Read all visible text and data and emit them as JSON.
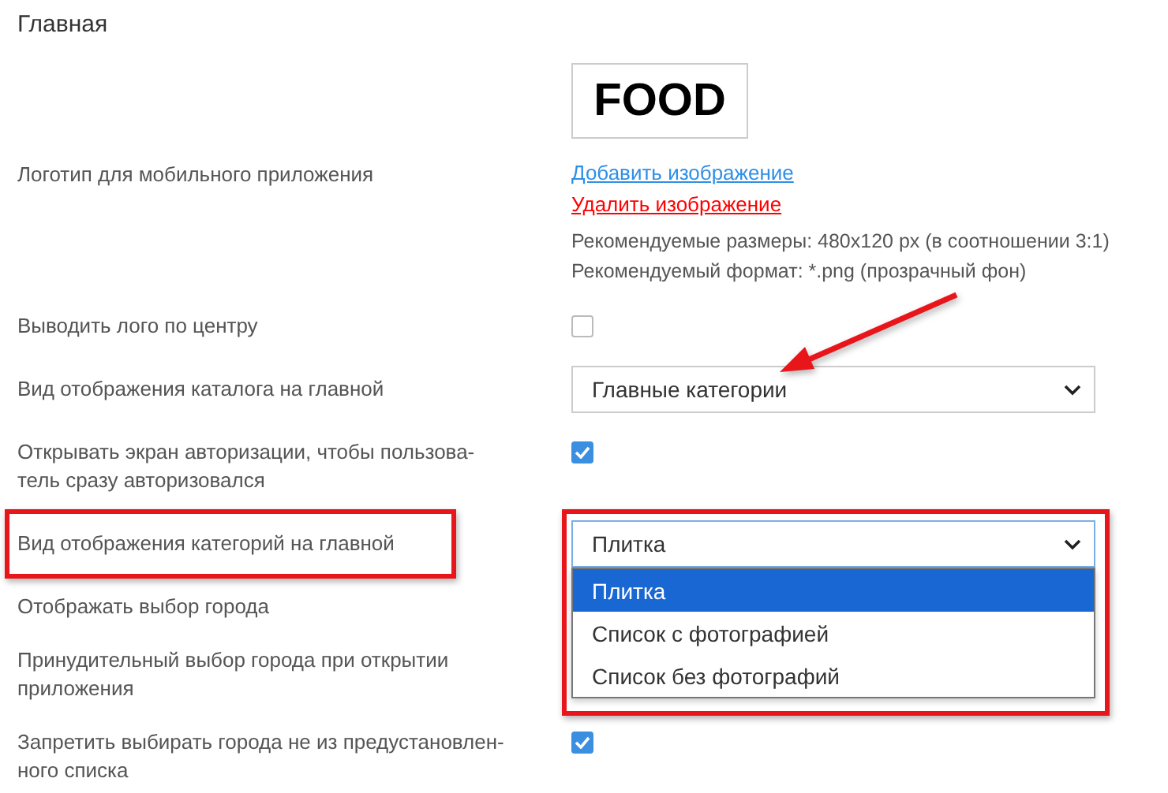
{
  "section_title": "Главная",
  "pointer_arrow": true,
  "rows": [
    {
      "kind": "logo",
      "label": "Логотип для мобильного приложения",
      "logo_text": "FOOD",
      "add_link": "Добавить изображение",
      "remove_link": "Удалить изображение",
      "hints": [
        "Рекомендуемые размеры: 480x120 px (в соотношении 3:1)",
        "Рекомендуемый формат: *.png (прозрачный фон)"
      ]
    },
    {
      "kind": "checkbox",
      "label": "Выводить лого по центру",
      "checked": false
    },
    {
      "kind": "select",
      "label": "Вид отображения каталога на главной",
      "value": "Главные категории",
      "expanded": false
    },
    {
      "kind": "checkbox",
      "label": "Открывать экран авторизации, чтобы пользова-тель сразу авторизовался",
      "checked": true
    },
    {
      "kind": "select",
      "label": "Вид отображения категорий на главной",
      "value": "Плитка",
      "expanded": true,
      "highlighted": true,
      "options": [
        {
          "label": "Плитка",
          "selected": true
        },
        {
          "label": "Список с фотографией",
          "selected": false
        },
        {
          "label": "Список без фотографий",
          "selected": false
        }
      ]
    },
    {
      "kind": "plain",
      "label": "Отображать выбор города"
    },
    {
      "kind": "plain",
      "label": "Принудительный выбор города при открытии приложения"
    },
    {
      "kind": "checkbox",
      "label": "Запретить выбирать города не из предустановлен-ного списка",
      "checked": true
    }
  ]
}
